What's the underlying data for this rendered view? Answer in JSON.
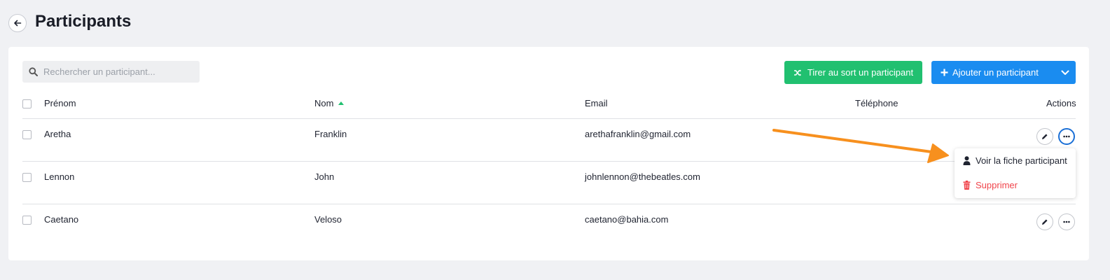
{
  "header": {
    "title": "Participants"
  },
  "search": {
    "placeholder": "Rechercher un participant..."
  },
  "toolbar": {
    "draw_label": "Tirer au sort un participant",
    "add_label": "Ajouter un participant"
  },
  "table": {
    "columns": {
      "firstname": "Prénom",
      "lastname": "Nom",
      "email": "Email",
      "phone": "Téléphone",
      "actions": "Actions"
    },
    "rows": [
      {
        "firstname": "Aretha",
        "lastname": "Franklin",
        "email": "arethafranklin@gmail.com",
        "phone": ""
      },
      {
        "firstname": "Lennon",
        "lastname": "John",
        "email": "johnlennon@thebeatles.com",
        "phone": ""
      },
      {
        "firstname": "Caetano",
        "lastname": "Veloso",
        "email": "caetano@bahia.com",
        "phone": ""
      }
    ]
  },
  "menu": {
    "view_label": "Voir la fiche participant",
    "delete_label": "Supprimer"
  },
  "colors": {
    "accent_green": "#21c070",
    "accent_blue": "#1a8cf0",
    "danger": "#f0444b",
    "annotation_arrow": "#f7901e"
  }
}
